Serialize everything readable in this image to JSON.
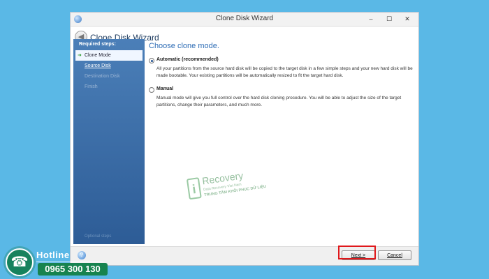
{
  "window": {
    "title": "Clone Disk Wizard",
    "controls": [
      "–",
      "☐",
      "✕"
    ]
  },
  "header": {
    "wizard_title": "Clone Disk Wizard"
  },
  "sidebar": {
    "title": "Required steps:",
    "steps": [
      {
        "label": "Clone Mode",
        "state": "active"
      },
      {
        "label": "Source Disk",
        "state": "link"
      },
      {
        "label": "Destination Disk",
        "state": "disabled"
      },
      {
        "label": "Finish",
        "state": "disabled"
      }
    ],
    "footer": "Optional steps"
  },
  "content": {
    "page_title": "Choose clone mode.",
    "options": [
      {
        "label": "Automatic (recommended)",
        "checked": true,
        "description": "All your partitions from the source hard disk will be copied to the target disk in a few simple steps and your new hard disk will be made bootable. Your existing partitions will be automatically resized to fit the target hard disk."
      },
      {
        "label": "Manual",
        "checked": false,
        "description": "Manual mode will give you full control over the hard disk cloning procedure. You will be able to adjust the size of the target partitions, change their parameters, and much more."
      }
    ]
  },
  "watermark": {
    "brand": "Recovery",
    "sub": "Data Recovery Viet Nam",
    "slogan": "TRUNG TÂM KHÔI PHỤC DỮ LIỆU"
  },
  "footer": {
    "next_label": "Next >",
    "cancel_label": "Cancel"
  },
  "hotline": {
    "label": "Hotline",
    "number": "0965 300 130"
  },
  "colors": {
    "background": "#5ab8e6",
    "sidebar": "#3a6ea8",
    "accent_title": "#2d6cb5",
    "highlight": "#e0181b",
    "hotline_green": "#17834f"
  }
}
